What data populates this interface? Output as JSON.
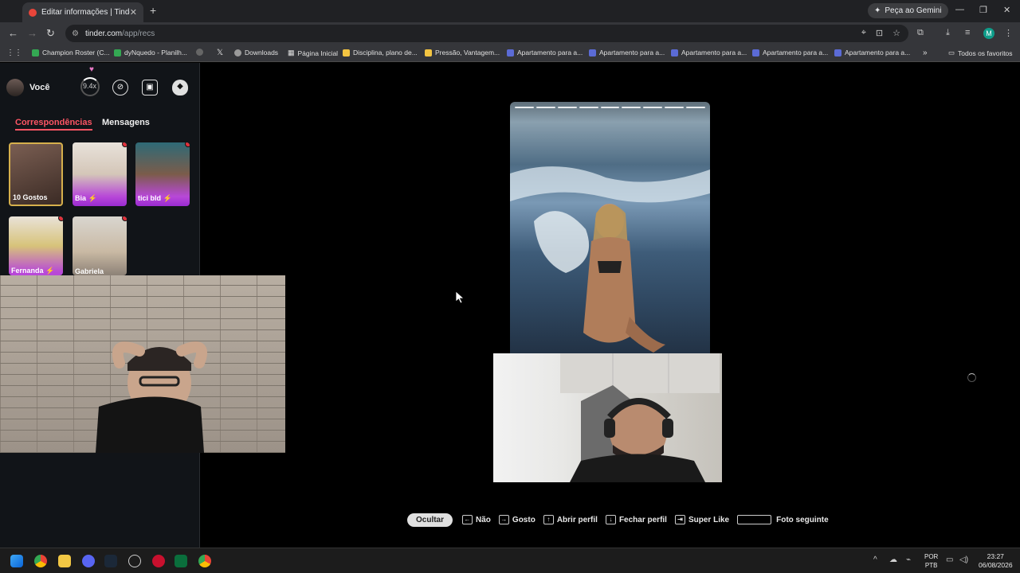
{
  "browser": {
    "tab_title": "Editar informações | Tinder",
    "gemini_label": "Peça ao Gemini",
    "url_host": "tinder.com",
    "url_path": "/app/recs",
    "bookmarks": [
      {
        "label": "Champion Roster (C...",
        "color": "#34a853"
      },
      {
        "label": "dyNquedo - Planilh...",
        "color": "#34a853"
      },
      {
        "label": "",
        "color": "#888888"
      },
      {
        "label": "",
        "color": "#ffffff"
      },
      {
        "label": "Downloads",
        "color": "#bbbbbb"
      },
      {
        "label": "Página Inicial",
        "color": "#cccccc"
      },
      {
        "label": "Disciplina, plano de...",
        "color": "#f4c542"
      },
      {
        "label": "Pressão, Vantagem...",
        "color": "#f4c542"
      },
      {
        "label": "Apartamento para a...",
        "color": "#5b6bd6"
      },
      {
        "label": "Apartamento para a...",
        "color": "#5b6bd6"
      },
      {
        "label": "Apartamento para a...",
        "color": "#5b6bd6"
      },
      {
        "label": "Apartamento para a...",
        "color": "#5b6bd6"
      },
      {
        "label": "Apartamento para a...",
        "color": "#5b6bd6"
      }
    ],
    "all_bookmarks": "Todos os favoritos",
    "profile_initial": "M"
  },
  "sidebar": {
    "user_label": "Você",
    "boost_value": "9.4x",
    "tab_matches": "Correspondências",
    "tab_messages": "Mensagens",
    "matches": [
      {
        "name": "10 Gostos",
        "type": "likes",
        "new": false
      },
      {
        "name": "Bia ⚡",
        "type": "match",
        "new": true
      },
      {
        "name": "tici bld ⚡",
        "type": "match",
        "new": true
      },
      {
        "name": "Fernanda ⚡",
        "type": "match",
        "new": true
      },
      {
        "name": "Gabriela",
        "type": "match",
        "new": true
      }
    ]
  },
  "profile_card": {
    "photo_count": 9,
    "current_photo": 1
  },
  "shortcuts": {
    "hide_label": "Ocultar",
    "items": [
      {
        "key": "←",
        "label": "Não"
      },
      {
        "key": "→",
        "label": "Gosto"
      },
      {
        "key": "↑",
        "label": "Abrir perfil"
      },
      {
        "key": "↓",
        "label": "Fechar perfil"
      },
      {
        "key": "⇥",
        "label": "Super Like"
      }
    ],
    "space_label": "Foto seguinte"
  },
  "taskbar": {
    "language": "POR",
    "layout": "PTB",
    "time": "23:27",
    "date": "06/08/2026"
  },
  "colors": {
    "tinder_accent": "#fd5564",
    "gold": "#d6b04c"
  }
}
